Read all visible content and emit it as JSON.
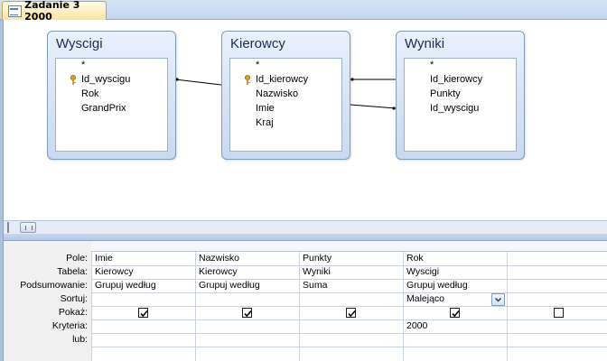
{
  "document_tab": {
    "title": "Zadanie 3 2000",
    "icon": "query-icon"
  },
  "diagram": {
    "tables": [
      {
        "name": "Wyscigi",
        "fields": [
          "*",
          "Id_wyscigu",
          "Rok",
          "GrandPrix"
        ],
        "key_field": "Id_wyscigu"
      },
      {
        "name": "Kierowcy",
        "fields": [
          "*",
          "Id_kierowcy",
          "Nazwisko",
          "Imie",
          "Kraj"
        ],
        "key_field": "Id_kierowcy"
      },
      {
        "name": "Wyniki",
        "fields": [
          "*",
          "Id_kierowcy",
          "Punkty",
          "Id_wyscigu"
        ],
        "key_field": ""
      }
    ]
  },
  "grid": {
    "row_labels": [
      "Pole:",
      "Tabela:",
      "Podsumowanie:",
      "Sortuj:",
      "Pokaż:",
      "Kryteria:",
      "lub:"
    ],
    "columns": [
      {
        "pole": "Imie",
        "tabela": "Kierowcy",
        "podsumowanie": "Grupuj według",
        "sortuj": "",
        "pokaz": true,
        "kryteria": "",
        "lub": ""
      },
      {
        "pole": "Nazwisko",
        "tabela": "Kierowcy",
        "podsumowanie": "Grupuj według",
        "sortuj": "",
        "pokaz": true,
        "kryteria": "",
        "lub": ""
      },
      {
        "pole": "Punkty",
        "tabela": "Wyniki",
        "podsumowanie": "Suma",
        "sortuj": "",
        "pokaz": true,
        "kryteria": "",
        "lub": ""
      },
      {
        "pole": "Rok",
        "tabela": "Wyscigi",
        "podsumowanie": "Grupuj według",
        "sortuj": "Malejąco",
        "pokaz": true,
        "kryteria": "2000",
        "lub": ""
      },
      {
        "pole": "",
        "tabela": "",
        "podsumowanie": "",
        "sortuj": "",
        "pokaz": false,
        "kryteria": "",
        "lub": ""
      }
    ]
  },
  "colors": {
    "accent": "#fbe3a2",
    "chrome": "#c9d8ec",
    "table_header": "#c9d9ef",
    "key_icon": "#d9a321"
  }
}
